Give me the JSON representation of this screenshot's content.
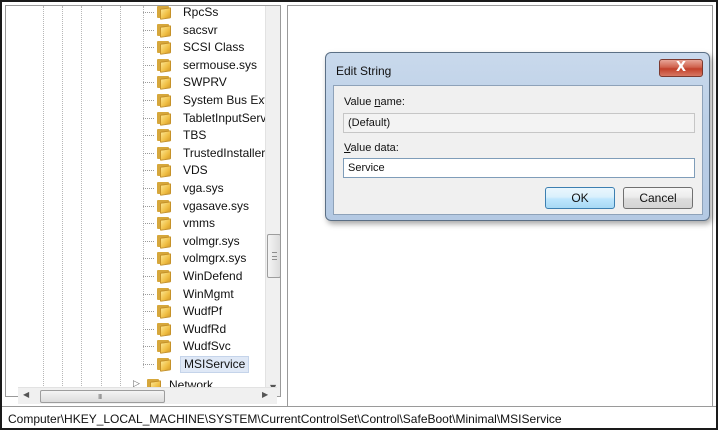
{
  "tree": {
    "items": [
      {
        "label": "RpcSs"
      },
      {
        "label": "sacsvr"
      },
      {
        "label": "SCSI Class"
      },
      {
        "label": "sermouse.sys"
      },
      {
        "label": "SWPRV"
      },
      {
        "label": "System Bus Exte"
      },
      {
        "label": "TabletInputServ"
      },
      {
        "label": "TBS"
      },
      {
        "label": "TrustedInstaller"
      },
      {
        "label": "VDS"
      },
      {
        "label": "vga.sys"
      },
      {
        "label": "vgasave.sys"
      },
      {
        "label": "vmms"
      },
      {
        "label": "volmgr.sys"
      },
      {
        "label": "volmgrx.sys"
      },
      {
        "label": "WinDefend"
      },
      {
        "label": "WinMgmt"
      },
      {
        "label": "WudfPf"
      },
      {
        "label": "WudfRd"
      },
      {
        "label": "WudfSvc"
      },
      {
        "label": "MSIService",
        "selected": true
      }
    ],
    "network_label": "Network",
    "folder_icon": "folder-icon"
  },
  "scrollbars": {
    "up_arrow": "▲",
    "down_arrow": "▼",
    "left_arrow": "◀",
    "right_arrow": "▶",
    "h_grip": "III"
  },
  "dialog": {
    "title": "Edit String",
    "close_glyph": "X",
    "value_name_label_pre": "Value ",
    "value_name_label_key": "n",
    "value_name_label_post": "ame:",
    "value_name": "(Default)",
    "value_data_label_key": "V",
    "value_data_label_post": "alue data:",
    "value_data": "Service",
    "ok_label": "OK",
    "cancel_label": "Cancel",
    "close_color": "#c2412b"
  },
  "status_bar": {
    "path": "Computer\\HKEY_LOCAL_MACHINE\\SYSTEM\\CurrentControlSet\\Control\\SafeBoot\\Minimal\\MSIService"
  }
}
